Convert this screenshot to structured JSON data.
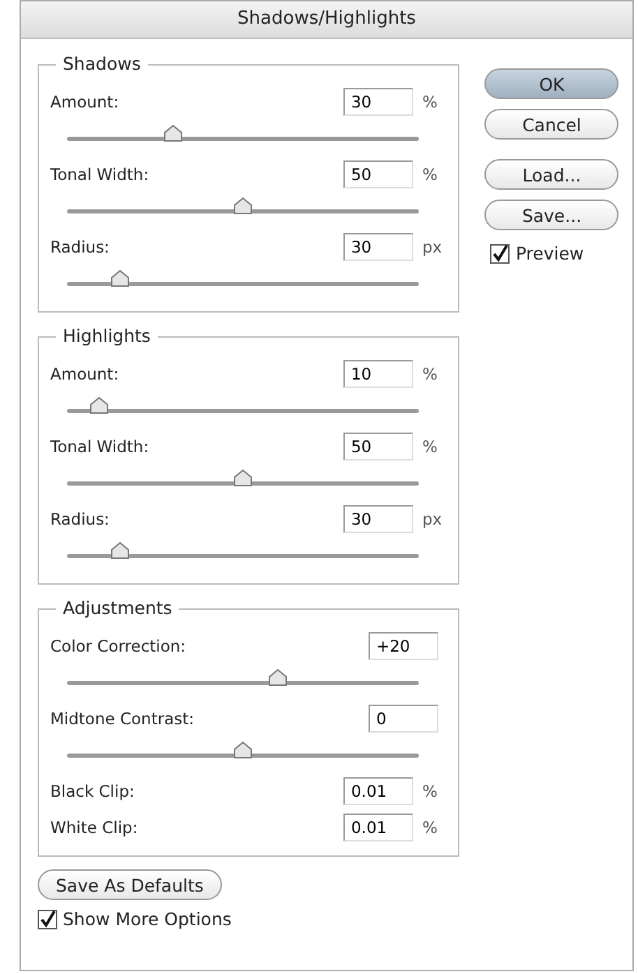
{
  "window": {
    "title": "Shadows/Highlights"
  },
  "groups": [
    {
      "title": "Shadows",
      "rows": [
        {
          "kind": "slider",
          "label": "Amount:",
          "value": "30",
          "unit": "%",
          "level": 0.3
        },
        {
          "kind": "slider",
          "label": "Tonal Width:",
          "value": "50",
          "unit": "%",
          "level": 0.5
        },
        {
          "kind": "slider",
          "label": "Radius:",
          "value": "30",
          "unit": "px",
          "level": 0.15
        }
      ]
    },
    {
      "title": "Highlights",
      "rows": [
        {
          "kind": "slider",
          "label": "Amount:",
          "value": "10",
          "unit": "%",
          "level": 0.09
        },
        {
          "kind": "slider",
          "label": "Tonal Width:",
          "value": "50",
          "unit": "%",
          "level": 0.5
        },
        {
          "kind": "slider",
          "label": "Radius:",
          "value": "30",
          "unit": "px",
          "level": 0.15
        }
      ]
    },
    {
      "title": "Adjustments",
      "rows": [
        {
          "kind": "slider",
          "label": "Color Correction:",
          "value": "+20",
          "level": 0.6
        },
        {
          "kind": "slider",
          "label": "Midtone Contrast:",
          "value": "0",
          "level": 0.5
        },
        {
          "kind": "field",
          "label": "Black Clip:",
          "value": "0.01",
          "unit": "%"
        },
        {
          "kind": "field",
          "label": "White Clip:",
          "value": "0.01",
          "unit": "%"
        }
      ]
    }
  ],
  "buttons": [
    {
      "label": "OK",
      "default": true
    },
    {
      "label": "Cancel",
      "default": false
    },
    {
      "label": "Load...",
      "default": false
    },
    {
      "label": "Save...",
      "default": false
    }
  ],
  "preview": {
    "label": "Preview",
    "checked": true
  },
  "save_defaults": {
    "label": "Save As Defaults"
  },
  "show_more": {
    "label": "Show More Options",
    "checked": true
  }
}
